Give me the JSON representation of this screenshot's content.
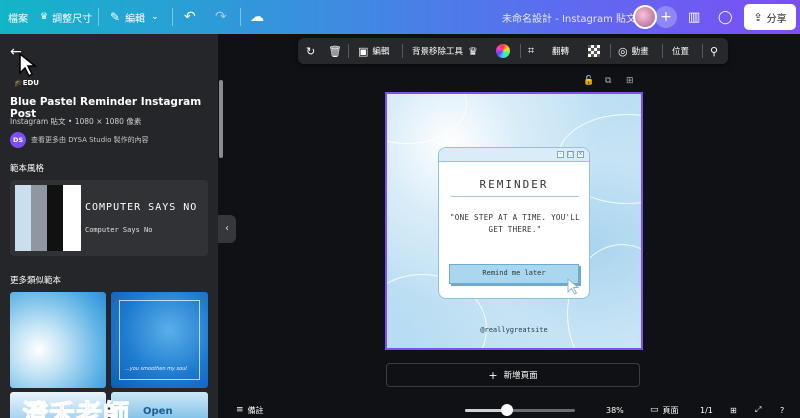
{
  "topbar": {
    "file_label": "檔案",
    "resize_label": "調整尺寸",
    "edit_label": "編輯",
    "design_title": "未命名設計 - Instagram 貼文",
    "share_label": "分享"
  },
  "left_panel": {
    "edu_badge": "EDU",
    "template_title": "Blue Pastel Reminder Instagram Post",
    "template_subtitle": "Instagram 貼文 • 1080 × 1080 像素",
    "author_initials": "DS",
    "author_text": "查看更多由 DYSA Studio 製作的內容",
    "style_heading": "範本風格",
    "style_swatches": [
      "#c9dfee",
      "#8f98a2",
      "#111111",
      "#ffffff"
    ],
    "style_font_primary": "COMPUTER SAYS NO",
    "style_font_secondary": "Computer Says No",
    "more_heading": "更多類似範本",
    "thumb2_text": "...you smoothen my soul",
    "thumb4_text": "Open",
    "watermark_text": "澄禾老師"
  },
  "context_toolbar": {
    "edit_label": "編輯",
    "bg_remover_label": "背景移除工具",
    "flip_label": "翻轉",
    "animate_label": "動畫",
    "position_label": "位置"
  },
  "design": {
    "title": "REMINDER",
    "quote": "\"ONE STEP AT A TIME. YOU'LL GET THERE.\"",
    "button_text": "Remind me later",
    "website": "@reallygreatsite"
  },
  "add_page_label": "新增頁面",
  "bottombar": {
    "notes_label": "備註",
    "zoom_value": "38%",
    "pages_label": "頁面",
    "page_count": "1/1"
  },
  "colors": {
    "accent": "#7d4ff5",
    "topbar_start": "#13b5c7",
    "topbar_end": "#7b4ff5"
  }
}
